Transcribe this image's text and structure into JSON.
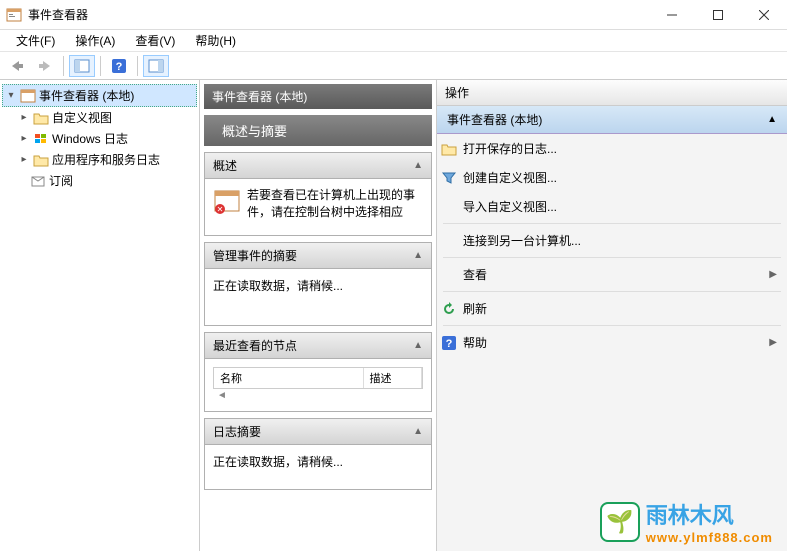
{
  "window": {
    "title": "事件查看器"
  },
  "menus": {
    "file": "文件(F)",
    "action": "操作(A)",
    "view": "查看(V)",
    "help": "帮助(H)"
  },
  "tree": {
    "root": "事件查看器 (本地)",
    "items": [
      {
        "label": "自定义视图"
      },
      {
        "label": "Windows 日志"
      },
      {
        "label": "应用程序和服务日志"
      },
      {
        "label": "订阅"
      }
    ]
  },
  "center": {
    "title": "事件查看器 (本地)",
    "subtitle": "概述与摘要",
    "sections": {
      "overview": {
        "title": "概述",
        "text": "若要查看已在计算机上出现的事件，请在控制台树中选择相应"
      },
      "summary": {
        "title": "管理事件的摘要",
        "text": "正在读取数据，请稍候..."
      },
      "recent": {
        "title": "最近查看的节点",
        "col_name": "名称",
        "col_desc": "描述"
      },
      "log": {
        "title": "日志摘要",
        "text": "正在读取数据，请稍候..."
      }
    }
  },
  "actions": {
    "header": "操作",
    "group": "事件查看器 (本地)",
    "items": {
      "open": "打开保存的日志...",
      "create": "创建自定义视图...",
      "import": "导入自定义视图...",
      "connect": "连接到另一台计算机...",
      "view": "查看",
      "refresh": "刷新",
      "help": "帮助"
    }
  },
  "watermark": {
    "text1": "雨林木风",
    "text2": "www.ylmf888.com"
  }
}
